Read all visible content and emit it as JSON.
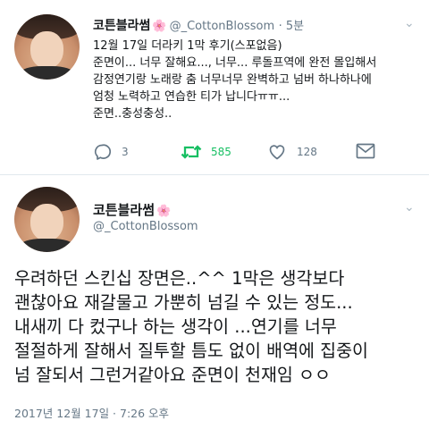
{
  "tweet1": {
    "display_name": "코튼블라썸",
    "handle": "@_CottonBlossom",
    "time": "· 5분",
    "emoji": "🌸",
    "lines": [
      "12월 17일 더라키 1막 후기(스포없음)",
      "준면이... 너무 잘해요..., 너무... 루돌프역에 완전 몰입해서",
      "감정연기랑 노래랑 춤 너무너무 완벽하고 넘버 하나하나에",
      "엄청 노력하고 연습한 티가 납니다ㅠㅠ...",
      "준면..충성충성.."
    ],
    "actions": {
      "replies": "3",
      "retweets": "585",
      "likes": "128"
    }
  },
  "tweet2": {
    "display_name": "코튼블라썸",
    "emoji": "🌸",
    "handle": "@_CottonBlossom",
    "lines": [
      "우려하던 스킨십 장면은..^^ 1막은 생각보다",
      "괜찮아요 재갈물고 가뿐히 넘길 수 있는 정도...",
      "내새끼 다 컸구나 하는 생각이 ...연기를 너무",
      "절절하게 잘해서 질투할 틈도 없이 배역에 집중이",
      "넘 잘되서 그런거같아요 준면이 천재임 ㅇㅇ"
    ],
    "timestamp": "2017년 12월 17일 · 7:26 오후"
  },
  "colors": {
    "retweet_active": "#17bf63",
    "secondary_text": "#657786"
  },
  "icons": [
    "avatar",
    "reply-icon",
    "retweet-icon",
    "like-icon",
    "direct-message-icon",
    "chevron-down-icon"
  ]
}
